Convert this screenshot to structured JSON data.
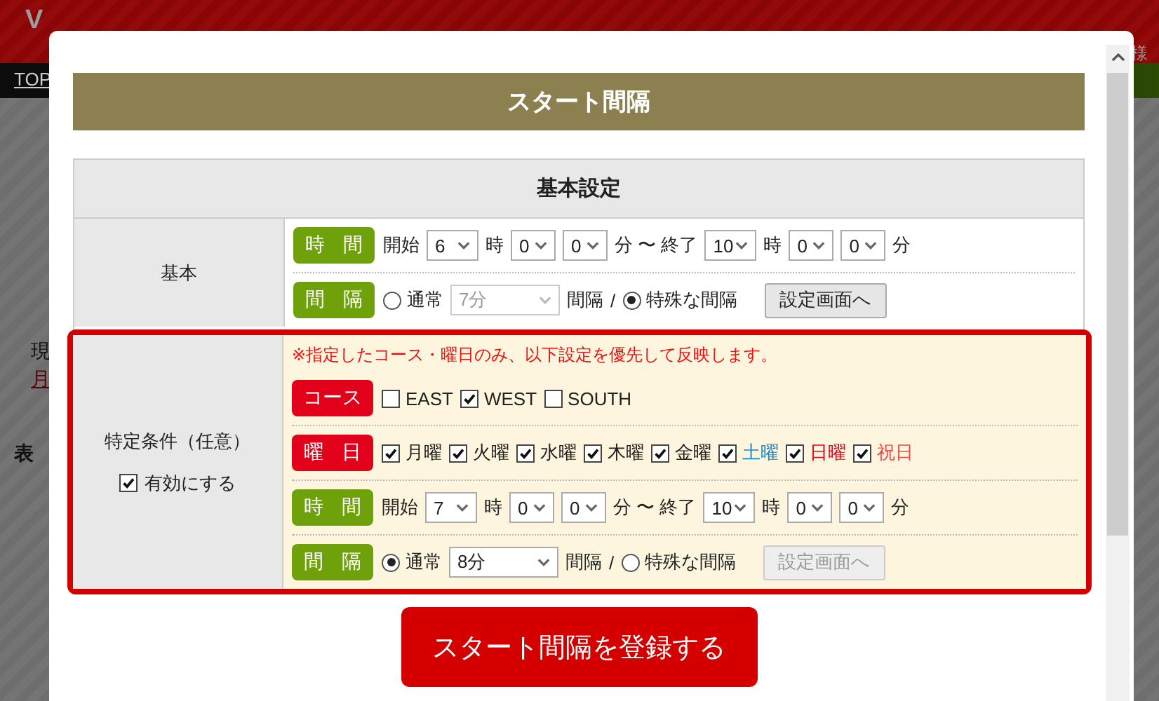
{
  "background": {
    "title": "V",
    "account": "様",
    "nav_link": "TOP",
    "fragments": [
      "現",
      "月",
      "表"
    ]
  },
  "modal": {
    "title": "スタート間隔",
    "section_title": "基本設定",
    "sections": [
      {
        "label": "基本",
        "rows": [
          {
            "tag": {
              "text": "時 間",
              "color": "#6ea10a"
            },
            "items": [
              {
                "kind": "text",
                "text": "開始"
              },
              {
                "kind": "hour-select",
                "value": "6"
              },
              {
                "kind": "text",
                "text": "時"
              },
              {
                "kind": "minute-select",
                "value": "0"
              },
              {
                "kind": "minute-select",
                "value": "0"
              },
              {
                "kind": "text",
                "text": "分 〜 終了"
              },
              {
                "kind": "hour-select",
                "value": "10"
              },
              {
                "kind": "text",
                "text": "時"
              },
              {
                "kind": "minute-select",
                "value": "0"
              },
              {
                "kind": "minute-select",
                "value": "0"
              },
              {
                "kind": "text",
                "text": "分"
              }
            ]
          },
          {
            "tag": {
              "text": "間 隔",
              "color": "#6ea10a"
            },
            "items": [
              {
                "kind": "radio",
                "label": "通常",
                "selected": false
              },
              {
                "kind": "interval-select",
                "value": "7分",
                "disabled": true
              },
              {
                "kind": "text",
                "text": "間隔"
              },
              {
                "kind": "text",
                "text": "/"
              },
              {
                "kind": "radio",
                "label": "特殊な間隔",
                "selected": true
              },
              {
                "kind": "button",
                "label": "設定画面へ",
                "disabled": false
              }
            ]
          }
        ]
      },
      {
        "label": "特定条件（任意）",
        "enable": {
          "label": "有効にする",
          "checked": true
        },
        "note": "※指定したコース・曜日のみ、以下設定を優先して反映します。",
        "rows": [
          {
            "tag": {
              "text": "コース",
              "color": "#e3001b"
            },
            "items": [
              {
                "kind": "checkbox",
                "label": "EAST",
                "checked": false
              },
              {
                "kind": "checkbox",
                "label": "WEST",
                "checked": true
              },
              {
                "kind": "checkbox",
                "label": "SOUTH",
                "checked": false
              }
            ]
          },
          {
            "tag": {
              "text": "曜 日",
              "color": "#e3001b"
            },
            "items": [
              {
                "kind": "checkbox",
                "label": "月曜",
                "checked": true,
                "color": "#222222"
              },
              {
                "kind": "checkbox",
                "label": "火曜",
                "checked": true,
                "color": "#222222"
              },
              {
                "kind": "checkbox",
                "label": "水曜",
                "checked": true,
                "color": "#222222"
              },
              {
                "kind": "checkbox",
                "label": "木曜",
                "checked": true,
                "color": "#222222"
              },
              {
                "kind": "checkbox",
                "label": "金曜",
                "checked": true,
                "color": "#222222"
              },
              {
                "kind": "checkbox",
                "label": "土曜",
                "checked": true,
                "color": "#1a8ad0"
              },
              {
                "kind": "checkbox",
                "label": "日曜",
                "checked": true,
                "color": "#e8001c"
              },
              {
                "kind": "checkbox",
                "label": "祝日",
                "checked": true,
                "color": "#f04848"
              }
            ]
          },
          {
            "tag": {
              "text": "時 間",
              "color": "#6ea10a"
            },
            "items": [
              {
                "kind": "text",
                "text": "開始"
              },
              {
                "kind": "hour-select",
                "value": "7"
              },
              {
                "kind": "text",
                "text": "時"
              },
              {
                "kind": "minute-select",
                "value": "0"
              },
              {
                "kind": "minute-select",
                "value": "0"
              },
              {
                "kind": "text",
                "text": "分 〜 終了"
              },
              {
                "kind": "hour-select",
                "value": "10"
              },
              {
                "kind": "text",
                "text": "時"
              },
              {
                "kind": "minute-select",
                "value": "0"
              },
              {
                "kind": "minute-select",
                "value": "0"
              },
              {
                "kind": "text",
                "text": "分"
              }
            ]
          },
          {
            "tag": {
              "text": "間 隔",
              "color": "#6ea10a"
            },
            "items": [
              {
                "kind": "radio",
                "label": "通常",
                "selected": true
              },
              {
                "kind": "interval-select",
                "value": "8分",
                "disabled": false
              },
              {
                "kind": "text",
                "text": "間隔"
              },
              {
                "kind": "text",
                "text": "/"
              },
              {
                "kind": "radio",
                "label": "特殊な間隔",
                "selected": false
              },
              {
                "kind": "button",
                "label": "設定画面へ",
                "disabled": true
              }
            ]
          }
        ]
      }
    ],
    "submit": "スタート間隔を登録する"
  }
}
